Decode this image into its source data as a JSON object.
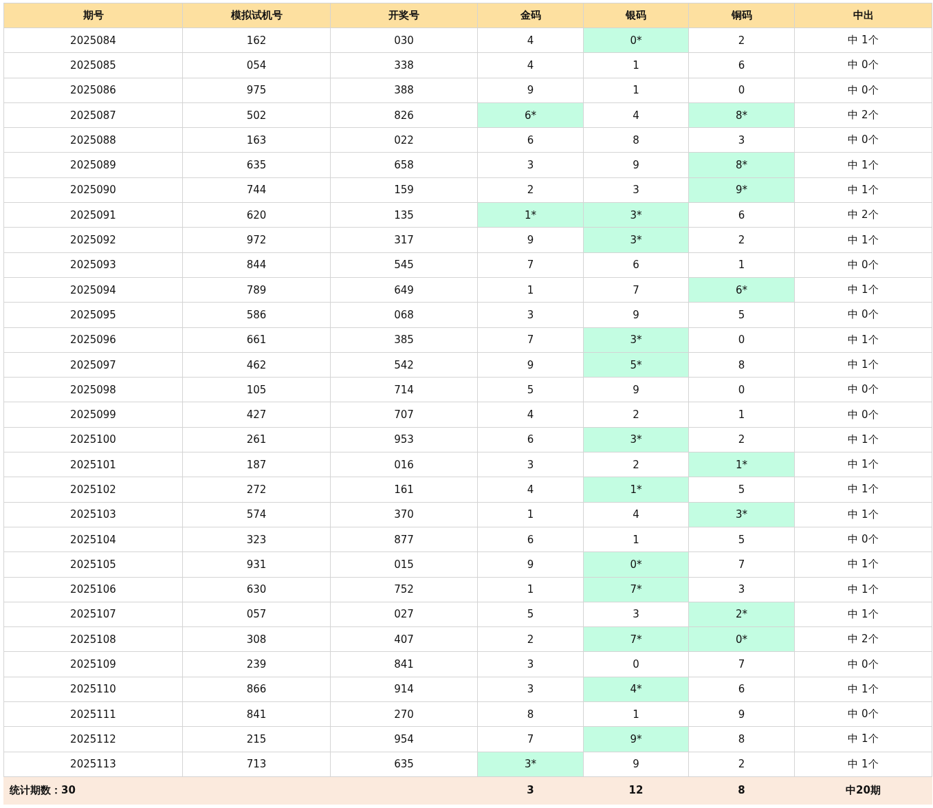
{
  "table": {
    "columns": [
      "期号",
      "模拟试机号",
      "开奖号",
      "金码",
      "银码",
      "铜码",
      "中出"
    ],
    "rows": [
      {
        "period": "2025084",
        "trial": "162",
        "draw": "030",
        "codes": [
          {
            "text": "4",
            "hit": false
          },
          {
            "text": "0*",
            "hit": true
          },
          {
            "text": "2",
            "hit": false
          }
        ],
        "result": "中 1个"
      },
      {
        "period": "2025085",
        "trial": "054",
        "draw": "338",
        "codes": [
          {
            "text": "4",
            "hit": false
          },
          {
            "text": "1",
            "hit": false
          },
          {
            "text": "6",
            "hit": false
          }
        ],
        "result": "中 0个"
      },
      {
        "period": "2025086",
        "trial": "975",
        "draw": "388",
        "codes": [
          {
            "text": "9",
            "hit": false
          },
          {
            "text": "1",
            "hit": false
          },
          {
            "text": "0",
            "hit": false
          }
        ],
        "result": "中 0个"
      },
      {
        "period": "2025087",
        "trial": "502",
        "draw": "826",
        "codes": [
          {
            "text": "6*",
            "hit": true
          },
          {
            "text": "4",
            "hit": false
          },
          {
            "text": "8*",
            "hit": true
          }
        ],
        "result": "中 2个"
      },
      {
        "period": "2025088",
        "trial": "163",
        "draw": "022",
        "codes": [
          {
            "text": "6",
            "hit": false
          },
          {
            "text": "8",
            "hit": false
          },
          {
            "text": "3",
            "hit": false
          }
        ],
        "result": "中 0个"
      },
      {
        "period": "2025089",
        "trial": "635",
        "draw": "658",
        "codes": [
          {
            "text": "3",
            "hit": false
          },
          {
            "text": "9",
            "hit": false
          },
          {
            "text": "8*",
            "hit": true
          }
        ],
        "result": "中 1个"
      },
      {
        "period": "2025090",
        "trial": "744",
        "draw": "159",
        "codes": [
          {
            "text": "2",
            "hit": false
          },
          {
            "text": "3",
            "hit": false
          },
          {
            "text": "9*",
            "hit": true
          }
        ],
        "result": "中 1个"
      },
      {
        "period": "2025091",
        "trial": "620",
        "draw": "135",
        "codes": [
          {
            "text": "1*",
            "hit": true
          },
          {
            "text": "3*",
            "hit": true
          },
          {
            "text": "6",
            "hit": false
          }
        ],
        "result": "中 2个"
      },
      {
        "period": "2025092",
        "trial": "972",
        "draw": "317",
        "codes": [
          {
            "text": "9",
            "hit": false
          },
          {
            "text": "3*",
            "hit": true
          },
          {
            "text": "2",
            "hit": false
          }
        ],
        "result": "中 1个"
      },
      {
        "period": "2025093",
        "trial": "844",
        "draw": "545",
        "codes": [
          {
            "text": "7",
            "hit": false
          },
          {
            "text": "6",
            "hit": false
          },
          {
            "text": "1",
            "hit": false
          }
        ],
        "result": "中 0个"
      },
      {
        "period": "2025094",
        "trial": "789",
        "draw": "649",
        "codes": [
          {
            "text": "1",
            "hit": false
          },
          {
            "text": "7",
            "hit": false
          },
          {
            "text": "6*",
            "hit": true
          }
        ],
        "result": "中 1个"
      },
      {
        "period": "2025095",
        "trial": "586",
        "draw": "068",
        "codes": [
          {
            "text": "3",
            "hit": false
          },
          {
            "text": "9",
            "hit": false
          },
          {
            "text": "5",
            "hit": false
          }
        ],
        "result": "中 0个"
      },
      {
        "period": "2025096",
        "trial": "661",
        "draw": "385",
        "codes": [
          {
            "text": "7",
            "hit": false
          },
          {
            "text": "3*",
            "hit": true
          },
          {
            "text": "0",
            "hit": false
          }
        ],
        "result": "中 1个"
      },
      {
        "period": "2025097",
        "trial": "462",
        "draw": "542",
        "codes": [
          {
            "text": "9",
            "hit": false
          },
          {
            "text": "5*",
            "hit": true
          },
          {
            "text": "8",
            "hit": false
          }
        ],
        "result": "中 1个"
      },
      {
        "period": "2025098",
        "trial": "105",
        "draw": "714",
        "codes": [
          {
            "text": "5",
            "hit": false
          },
          {
            "text": "9",
            "hit": false
          },
          {
            "text": "0",
            "hit": false
          }
        ],
        "result": "中 0个"
      },
      {
        "period": "2025099",
        "trial": "427",
        "draw": "707",
        "codes": [
          {
            "text": "4",
            "hit": false
          },
          {
            "text": "2",
            "hit": false
          },
          {
            "text": "1",
            "hit": false
          }
        ],
        "result": "中 0个"
      },
      {
        "period": "2025100",
        "trial": "261",
        "draw": "953",
        "codes": [
          {
            "text": "6",
            "hit": false
          },
          {
            "text": "3*",
            "hit": true
          },
          {
            "text": "2",
            "hit": false
          }
        ],
        "result": "中 1个"
      },
      {
        "period": "2025101",
        "trial": "187",
        "draw": "016",
        "codes": [
          {
            "text": "3",
            "hit": false
          },
          {
            "text": "2",
            "hit": false
          },
          {
            "text": "1*",
            "hit": true
          }
        ],
        "result": "中 1个"
      },
      {
        "period": "2025102",
        "trial": "272",
        "draw": "161",
        "codes": [
          {
            "text": "4",
            "hit": false
          },
          {
            "text": "1*",
            "hit": true
          },
          {
            "text": "5",
            "hit": false
          }
        ],
        "result": "中 1个"
      },
      {
        "period": "2025103",
        "trial": "574",
        "draw": "370",
        "codes": [
          {
            "text": "1",
            "hit": false
          },
          {
            "text": "4",
            "hit": false
          },
          {
            "text": "3*",
            "hit": true
          }
        ],
        "result": "中 1个"
      },
      {
        "period": "2025104",
        "trial": "323",
        "draw": "877",
        "codes": [
          {
            "text": "6",
            "hit": false
          },
          {
            "text": "1",
            "hit": false
          },
          {
            "text": "5",
            "hit": false
          }
        ],
        "result": "中 0个"
      },
      {
        "period": "2025105",
        "trial": "931",
        "draw": "015",
        "codes": [
          {
            "text": "9",
            "hit": false
          },
          {
            "text": "0*",
            "hit": true
          },
          {
            "text": "7",
            "hit": false
          }
        ],
        "result": "中 1个"
      },
      {
        "period": "2025106",
        "trial": "630",
        "draw": "752",
        "codes": [
          {
            "text": "1",
            "hit": false
          },
          {
            "text": "7*",
            "hit": true
          },
          {
            "text": "3",
            "hit": false
          }
        ],
        "result": "中 1个"
      },
      {
        "period": "2025107",
        "trial": "057",
        "draw": "027",
        "codes": [
          {
            "text": "5",
            "hit": false
          },
          {
            "text": "3",
            "hit": false
          },
          {
            "text": "2*",
            "hit": true
          }
        ],
        "result": "中 1个"
      },
      {
        "period": "2025108",
        "trial": "308",
        "draw": "407",
        "codes": [
          {
            "text": "2",
            "hit": false
          },
          {
            "text": "7*",
            "hit": true
          },
          {
            "text": "0*",
            "hit": true
          }
        ],
        "result": "中 2个"
      },
      {
        "period": "2025109",
        "trial": "239",
        "draw": "841",
        "codes": [
          {
            "text": "3",
            "hit": false
          },
          {
            "text": "0",
            "hit": false
          },
          {
            "text": "7",
            "hit": false
          }
        ],
        "result": "中 0个"
      },
      {
        "period": "2025110",
        "trial": "866",
        "draw": "914",
        "codes": [
          {
            "text": "3",
            "hit": false
          },
          {
            "text": "4*",
            "hit": true
          },
          {
            "text": "6",
            "hit": false
          }
        ],
        "result": "中 1个"
      },
      {
        "period": "2025111",
        "trial": "841",
        "draw": "270",
        "codes": [
          {
            "text": "8",
            "hit": false
          },
          {
            "text": "1",
            "hit": false
          },
          {
            "text": "9",
            "hit": false
          }
        ],
        "result": "中 0个"
      },
      {
        "period": "2025112",
        "trial": "215",
        "draw": "954",
        "codes": [
          {
            "text": "7",
            "hit": false
          },
          {
            "text": "9*",
            "hit": true
          },
          {
            "text": "8",
            "hit": false
          }
        ],
        "result": "中 1个"
      },
      {
        "period": "2025113",
        "trial": "713",
        "draw": "635",
        "codes": [
          {
            "text": "3*",
            "hit": true
          },
          {
            "text": "9",
            "hit": false
          },
          {
            "text": "2",
            "hit": false
          }
        ],
        "result": "中 1个"
      }
    ],
    "footer": {
      "label": "统计期数：30",
      "totals": [
        "3",
        "12",
        "8"
      ],
      "result": "中20期"
    }
  }
}
